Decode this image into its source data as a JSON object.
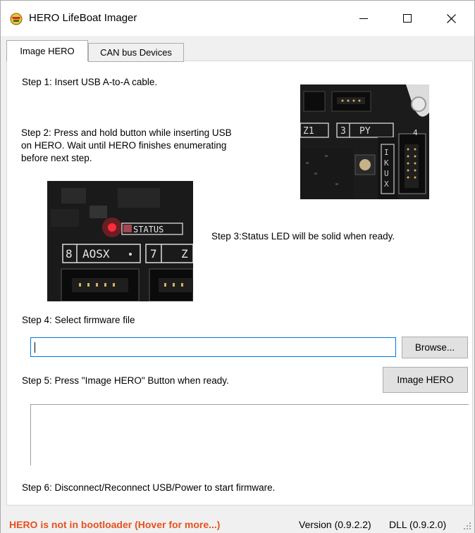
{
  "window": {
    "title": "HERO LifeBoat Imager"
  },
  "tabs": [
    {
      "label": "Image HERO",
      "active": true
    },
    {
      "label": "CAN bus Devices",
      "active": false
    }
  ],
  "steps": {
    "step1": "Step 1: Insert USB A-to-A cable.",
    "step2_line1": "Step 2: Press and hold button while inserting USB",
    "step2_line2": "on HERO.  Wait until HERO finishes enumerating",
    "step2_line3": "before next step.",
    "step3": "Step 3:Status LED will be solid when ready.",
    "step4": "Step 4: Select firmware file",
    "step5": "Step 5: Press \"Image HERO\" Button  when ready.",
    "step6": "Step 6: Disconnect/Reconnect USB/Power to start firmware."
  },
  "photo_top": {
    "labels": [
      "Z1",
      "3",
      "PY",
      "I",
      "K",
      "U",
      "X",
      "4"
    ]
  },
  "photo_bottom": {
    "labels": [
      "STATUS",
      "8",
      "AOSX",
      "7",
      "Z"
    ]
  },
  "firmware": {
    "value": "",
    "browse_label": "Browse..."
  },
  "image_button_label": "Image HERO",
  "statusbar": {
    "warning": "HERO is not in bootloader (Hover for more...)",
    "version": "Version (0.9.2.2)",
    "dll": "DLL (0.9.2.0)"
  },
  "colors": {
    "warning": "#e8501e",
    "focus": "#0078d7",
    "led": "#ff2a3a"
  }
}
